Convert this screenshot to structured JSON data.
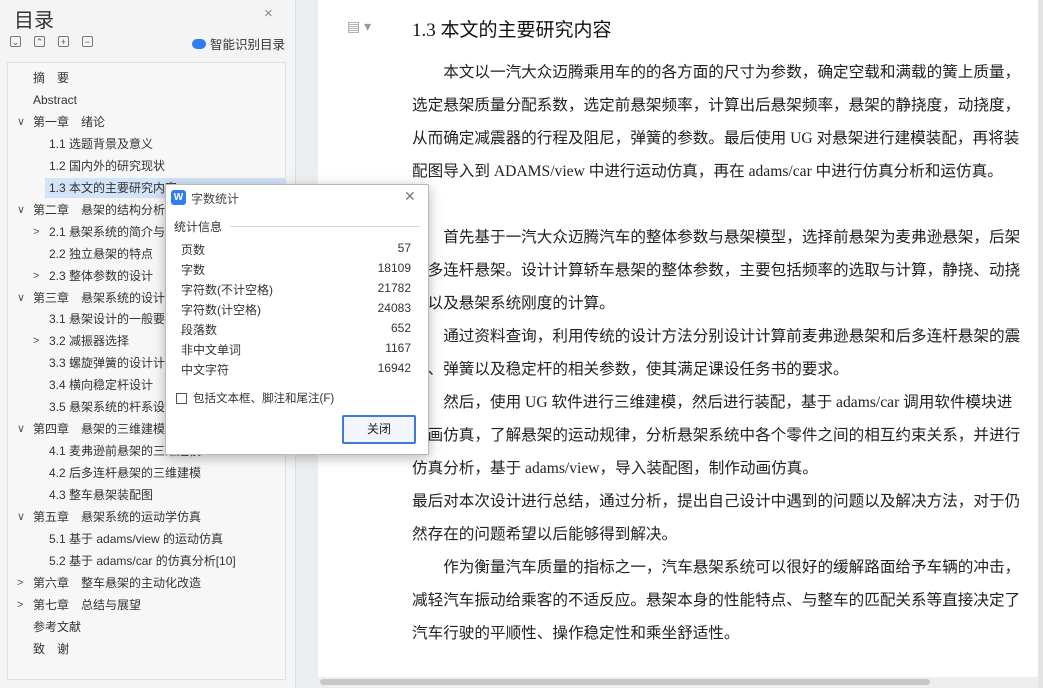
{
  "nav": {
    "title": "目录",
    "close_glyph": "×",
    "toolbar": [
      "⌄",
      "⌃",
      "+",
      "−"
    ],
    "smart_label": "智能识别目录",
    "items": [
      {
        "label": "摘　要",
        "level": 0,
        "chevron": ""
      },
      {
        "label": "Abstract",
        "level": 0,
        "chevron": ""
      },
      {
        "label": "第一章　绪论",
        "level": 0,
        "chevron": "∨"
      },
      {
        "label": "1.1 选题背景及意义",
        "level": 1,
        "chevron": ""
      },
      {
        "label": "1.2 国内外的研究现状",
        "level": 1,
        "chevron": ""
      },
      {
        "label": "1.3 本文的主要研究内容",
        "level": 1,
        "chevron": "",
        "selected": true
      },
      {
        "label": "第二章　悬架的结构分析",
        "level": 0,
        "chevron": "∨"
      },
      {
        "label": "2.1 悬架系统的简介与",
        "level": 1,
        "chevron": ">"
      },
      {
        "label": "2.2 独立悬架的特点",
        "level": 1,
        "chevron": ""
      },
      {
        "label": "2.3 整体参数的设计",
        "level": 1,
        "chevron": ">"
      },
      {
        "label": "第三章　悬架系统的设计",
        "level": 0,
        "chevron": "∨"
      },
      {
        "label": "3.1 悬架设计的一般要",
        "level": 1,
        "chevron": ""
      },
      {
        "label": "3.2 减振器选择",
        "level": 1,
        "chevron": ">"
      },
      {
        "label": "3.3 螺旋弹簧的设计计",
        "level": 1,
        "chevron": ""
      },
      {
        "label": "3.4 横向稳定杆设计",
        "level": 1,
        "chevron": ""
      },
      {
        "label": "3.5 悬架系统的杆系设",
        "level": 1,
        "chevron": ""
      },
      {
        "label": "第四章　悬架的三维建模",
        "level": 0,
        "chevron": "∨"
      },
      {
        "label": "4.1 麦弗逊前悬架的三维建模",
        "level": 1,
        "chevron": ""
      },
      {
        "label": "4.2 后多连杆悬架的三维建模",
        "level": 1,
        "chevron": ""
      },
      {
        "label": "4.3 整车悬架装配图",
        "level": 1,
        "chevron": ""
      },
      {
        "label": "第五章　悬架系统的运动学仿真",
        "level": 0,
        "chevron": "∨"
      },
      {
        "label": "5.1 基于 adams/view 的运动仿真",
        "level": 1,
        "chevron": ""
      },
      {
        "label": "5.2 基于 adams/car 的仿真分析[10]",
        "level": 1,
        "chevron": ""
      },
      {
        "label": "第六章　整车悬架的主动化改造",
        "level": 0,
        "chevron": ">"
      },
      {
        "label": "第七章　总结与展望",
        "level": 0,
        "chevron": ">"
      },
      {
        "label": "参考文献",
        "level": 0,
        "chevron": ""
      },
      {
        "label": "致　谢",
        "level": 0,
        "chevron": ""
      }
    ]
  },
  "document": {
    "heading": "1.3 本文的主要研究内容",
    "paragraphs": [
      {
        "indent": true,
        "text": "本文以一汽大众迈腾乘用车的的各方面的尺寸为参数，确定空载和满载的簧上质量，选定悬架质量分配系数，选定前悬架频率，计算出后悬架频率，悬架的静挠度，动挠度，从而确定减震器的行程及阻尼，弹簧的参数。最后使用 UG 对悬架进行建模装配，再将装配图导入到 ADAMS/view 中进行运动仿真，再在 adams/car 中进行仿真分析和运仿真。"
      },
      {
        "indent": true,
        "text": "首先基于一汽大众迈腾汽车的整体参数与悬架模型，选择前悬架为麦弗逊悬架，后架为多连杆悬架。设计计算轿车悬架的整体参数，主要包括频率的选取与计算，静挠、动挠度以及悬架系统刚度的计算。"
      },
      {
        "indent": true,
        "text": "通过资料查询，利用传统的设计方法分别设计计算前麦弗逊悬架和后多连杆悬架的震器、弹簧以及稳定杆的相关参数，使其满足课设任务书的要求。"
      },
      {
        "indent": true,
        "text": "然后，使用 UG 软件进行三维建模，然后进行装配，基于 adams/car 调用软件模块进动画仿真，了解悬架的运动规律，分析悬架系统中各个零件之间的相互约束关系，并进行仿真分析，基于 adams/view，导入装配图，制作动画仿真。"
      },
      {
        "indent": false,
        "text": "最后对本次设计进行总结，通过分析，提出自己设计中遇到的问题以及解决方法，对于仍然存在的问题希望以后能够得到解决。"
      },
      {
        "indent": true,
        "text": "作为衡量汽车质量的指标之一，汽车悬架系统可以很好的缓解路面给予车辆的冲击，减轻汽车振动给乘客的不适反应。悬架本身的性能特点、与整车的匹配关系等直接决定了汽车行驶的平顺性、操作稳定性和乘坐舒适性。"
      }
    ]
  },
  "dialog": {
    "title": "字数统计",
    "group_label": "统计信息",
    "stats": [
      {
        "label": "页数",
        "value": "57"
      },
      {
        "label": "字数",
        "value": "18109"
      },
      {
        "label": "字符数(不计空格)",
        "value": "21782"
      },
      {
        "label": "字符数(计空格)",
        "value": "24083"
      },
      {
        "label": "段落数",
        "value": "652"
      },
      {
        "label": "非中文单词",
        "value": "1167"
      },
      {
        "label": "中文字符",
        "value": "16942"
      }
    ],
    "checkbox_label": "包括文本框、脚注和尾注(F)",
    "checkbox_checked": false,
    "close_button": "关闭"
  }
}
